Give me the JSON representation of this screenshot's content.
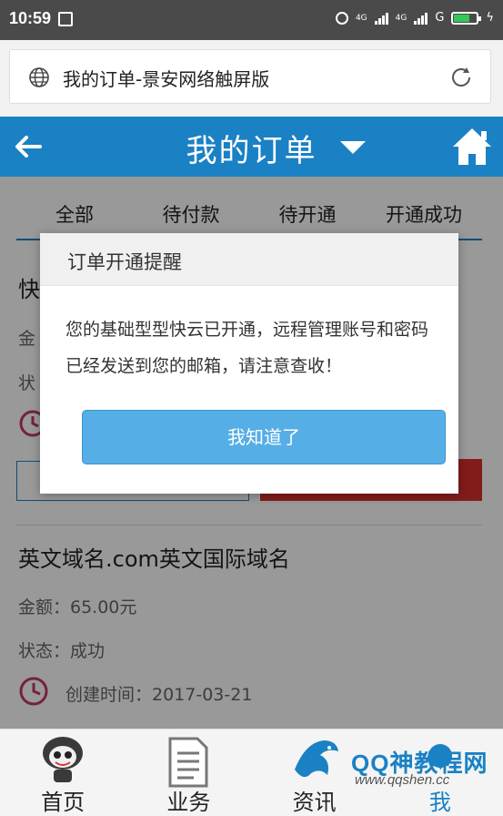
{
  "status_bar": {
    "time": "10:59",
    "network_small": "4G",
    "network_small_2": "4G",
    "carrier": "G"
  },
  "browser": {
    "page_title": "我的订单-景安网络触屏版"
  },
  "header": {
    "title": "我的订单"
  },
  "tabs": [
    "全部",
    "待付款",
    "待开通",
    "开通成功"
  ],
  "orders": [
    {
      "title": "快",
      "amount_label": "金",
      "status_label": "状"
    },
    {
      "title": "英文域名.com英文国际域名",
      "amount": "金额：65.00元",
      "status": "状态：成功",
      "created": "创建时间：2017-03-21"
    }
  ],
  "dialog": {
    "title": "订单开通提醒",
    "message": "您的基础型型快云已开通，远程管理账号和密码已经发送到您的邮箱，请注意查收！",
    "confirm_label": "我知道了"
  },
  "bottom_nav": [
    {
      "label": "首页",
      "icon": "mascot-icon"
    },
    {
      "label": "业务",
      "icon": "document-icon"
    },
    {
      "label": "资讯",
      "icon": "dragon-icon"
    },
    {
      "label": "我",
      "icon": "user-icon"
    }
  ],
  "watermark": {
    "text": "QQ神教程网",
    "url": "www.qqshen.cc"
  },
  "colors": {
    "brand_blue": "#1a81c4",
    "button_blue": "#56aee6",
    "danger_red": "#d9302c",
    "clock_pink": "#c23a6a"
  }
}
